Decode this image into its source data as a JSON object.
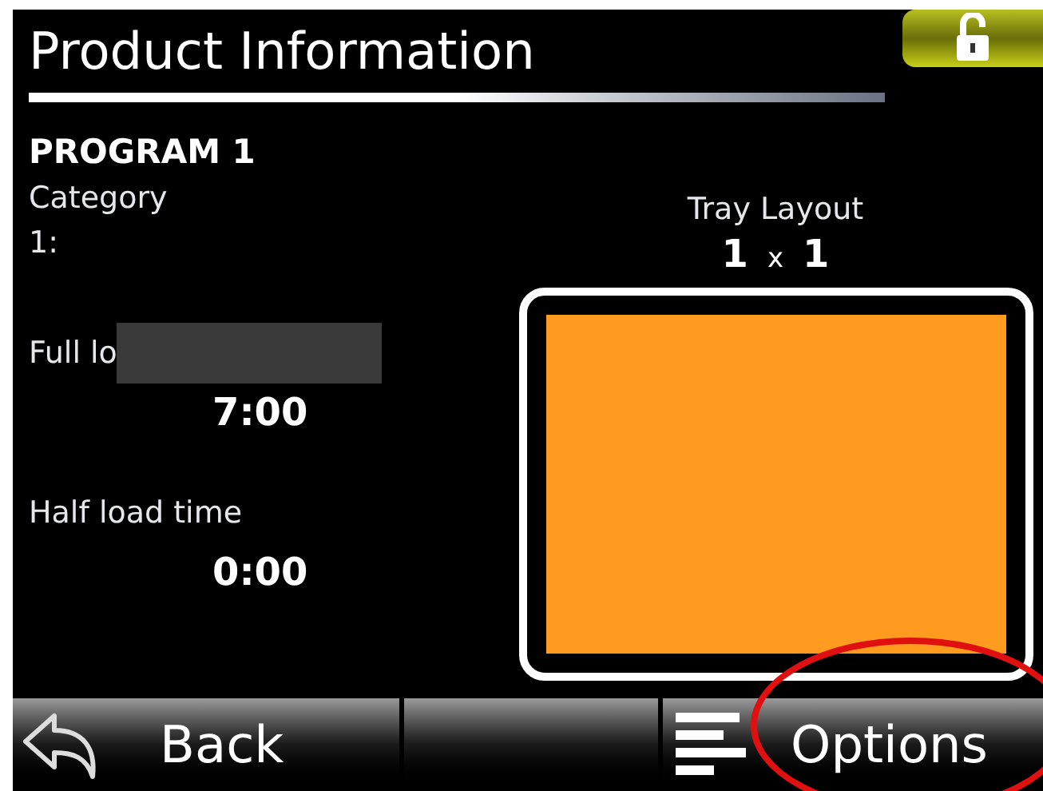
{
  "header": {
    "title": "Product Information",
    "locked": false
  },
  "program": "PROGRAM 1",
  "category": {
    "label": "Category",
    "value": "1:"
  },
  "times": [
    {
      "label": "Full lo",
      "value": "7:00",
      "redacted": true
    },
    {
      "label": "Half load time",
      "value": "0:00",
      "redacted": false
    }
  ],
  "tray_layout": {
    "label": "Tray Layout",
    "rows": "1",
    "separator": "x",
    "columns": "1"
  },
  "buttons": [
    {
      "kind": "back",
      "label": "Back"
    },
    {
      "kind": "blank"
    },
    {
      "kind": "options",
      "label": "Options",
      "circled": true
    }
  ]
}
